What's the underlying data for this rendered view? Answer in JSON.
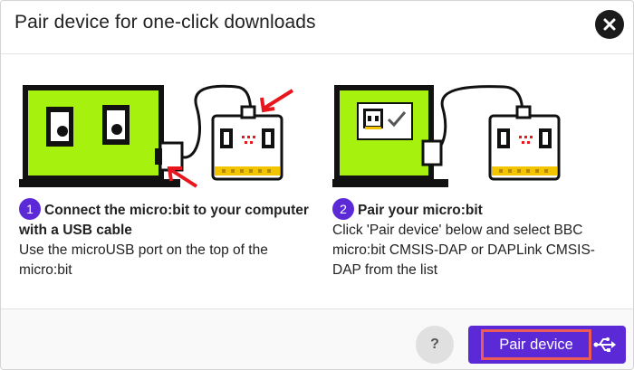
{
  "dialog": {
    "title": "Pair device for one-click downloads"
  },
  "steps": [
    {
      "number": "1",
      "heading": "Connect the micro:bit to your computer with a USB cable",
      "description": "Use the microUSB port on the top of the micro:bit"
    },
    {
      "number": "2",
      "heading": "Pair your micro:bit",
      "description": "Click 'Pair device' below and select BBC micro:bit CMSIS-DAP or DAPLink CMSIS-DAP from the list"
    }
  ],
  "footer": {
    "help_label": "?",
    "pair_label": "Pair device",
    "pair_icon": "usb-icon"
  },
  "colors": {
    "accent": "#5b2ad6",
    "highlight_border": "#ec5b57",
    "screen_green": "#a6f20e",
    "arrow_red": "#e8161d"
  }
}
